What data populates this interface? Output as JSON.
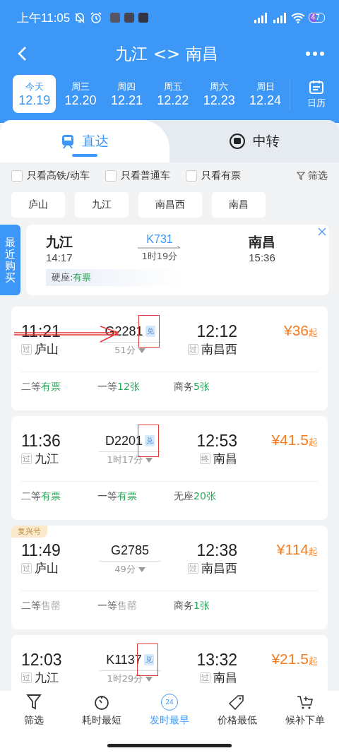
{
  "status_bar": {
    "time": "上午11:05",
    "battery": "47"
  },
  "nav": {
    "title": "九江 <> 南昌"
  },
  "dates": [
    {
      "weekday": "今天",
      "date": "12.19",
      "selected": true
    },
    {
      "weekday": "周三",
      "date": "12.20",
      "selected": false
    },
    {
      "weekday": "周四",
      "date": "12.21",
      "selected": false
    },
    {
      "weekday": "周五",
      "date": "12.22",
      "selected": false
    },
    {
      "weekday": "周六",
      "date": "12.23",
      "selected": false
    },
    {
      "weekday": "周日",
      "date": "12.24",
      "selected": false
    }
  ],
  "calendar_label": "日历",
  "tabs": [
    {
      "label": "直达",
      "selected": true
    },
    {
      "label": "中转",
      "selected": false
    }
  ],
  "filters": [
    {
      "label": "只看高铁/动车",
      "checked": false
    },
    {
      "label": "只看普通车",
      "checked": false
    },
    {
      "label": "只看有票",
      "checked": false
    }
  ],
  "filter_button": "筛选",
  "stations": [
    "庐山",
    "九江",
    "南昌西",
    "南昌"
  ],
  "recent": {
    "tab_label": "最近购买",
    "from": "九江",
    "depart": "14:17",
    "train": "K731",
    "duration": "1时19分",
    "to": "南昌",
    "arrive": "15:36",
    "seat": "硬座:",
    "status": "有票"
  },
  "trains": [
    {
      "depart": "11:21",
      "from_tag": "过",
      "from": "庐山",
      "train": "G2281",
      "badge": "兑",
      "duration": "51分",
      "arrive": "12:12",
      "to_tag": "过",
      "to": "南昌西",
      "price": "¥36",
      "price_suffix": "起",
      "highlighted": true,
      "arrow": true,
      "seats": [
        {
          "name": "二等",
          "status": "有票",
          "available": true
        },
        {
          "name": "一等",
          "status": "12张",
          "available": true
        },
        {
          "name": "商务",
          "status": "5张",
          "available": true
        }
      ]
    },
    {
      "depart": "11:36",
      "from_tag": "过",
      "from": "九江",
      "train": "D2201",
      "badge": "兑",
      "duration": "1时17分",
      "arrive": "12:53",
      "to_tag": "终",
      "to": "南昌",
      "price": "¥41.5",
      "price_suffix": "起",
      "highlighted": true,
      "arrow": false,
      "seats": [
        {
          "name": "二等",
          "status": "有票",
          "available": true
        },
        {
          "name": "一等",
          "status": "有票",
          "available": true
        },
        {
          "name": "无座",
          "status": "20张",
          "available": true
        }
      ]
    },
    {
      "tag": "复兴号",
      "depart": "11:49",
      "from_tag": "过",
      "from": "庐山",
      "train": "G2785",
      "duration": "49分",
      "arrive": "12:38",
      "to_tag": "过",
      "to": "南昌西",
      "price": "¥114",
      "price_suffix": "起",
      "arrow": false,
      "seats": [
        {
          "name": "二等",
          "status": "售罄",
          "available": false
        },
        {
          "name": "一等",
          "status": "售罄",
          "available": false
        },
        {
          "name": "商务",
          "status": "1张",
          "available": true
        }
      ]
    },
    {
      "depart": "12:03",
      "from_tag": "过",
      "from": "九江",
      "train": "K1137",
      "badge": "兑",
      "duration": "1时29分",
      "arrive": "13:32",
      "to_tag": "过",
      "to": "南昌",
      "price": "¥21.5",
      "price_suffix": "起",
      "highlighted": true,
      "arrow": false
    }
  ],
  "bottom_nav": [
    {
      "label": "筛选",
      "kind": "filter",
      "selected": false
    },
    {
      "label": "耗时最短",
      "kind": "duration",
      "selected": false
    },
    {
      "label": "发时最早",
      "kind": "earliest",
      "icon_text": "24",
      "selected": true
    },
    {
      "label": "价格最低",
      "kind": "price",
      "selected": false
    },
    {
      "label": "候补下单",
      "kind": "waitlist",
      "selected": false
    }
  ]
}
